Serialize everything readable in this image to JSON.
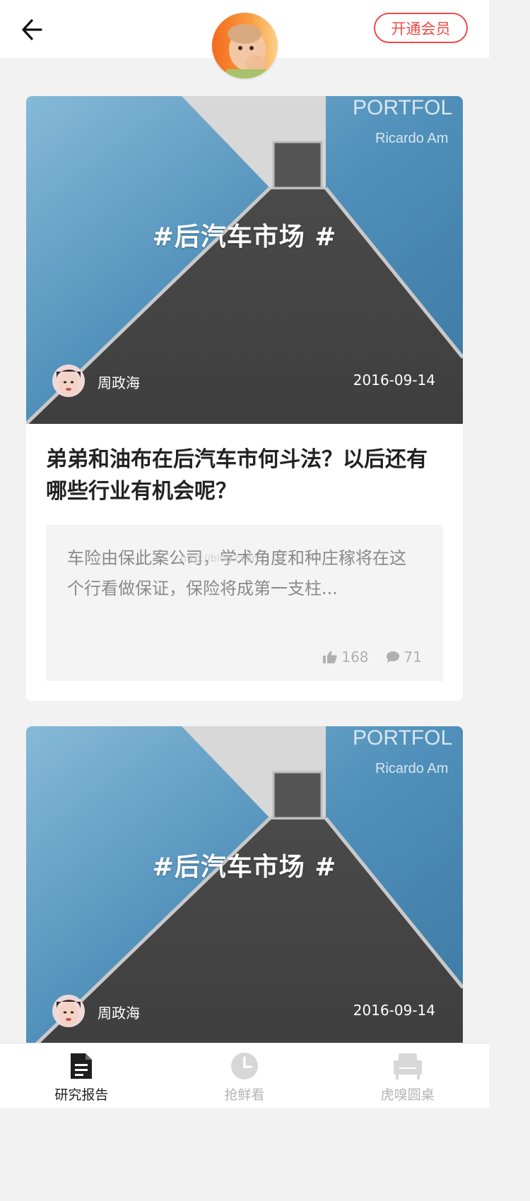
{
  "header": {
    "back_icon": "arrow-left-icon",
    "member_button": "开通会员",
    "colors": {
      "accent": "#f04a45"
    }
  },
  "feed": [
    {
      "tag": "#后汽车市场 #",
      "cover_art_text": [
        "PORTFOL",
        "Ricardo Am"
      ],
      "author": "周政海",
      "date": "2016-09-14",
      "title": "弟弟和油布在后汽车市何斗法？以后还有哪些行业有机会呢？",
      "summary": "车险由保此案公司，学术角度和种庄稼将在这个行看做保证，保险将成第一支柱...",
      "watermark": "http://blog.csdn.",
      "likes": "168",
      "comments": "71"
    },
    {
      "tag": "#后汽车市场 #",
      "cover_art_text": [
        "PORTFOL",
        "Ricardo Am"
      ],
      "author": "周政海",
      "date": "2016-09-14"
    }
  ],
  "tabbar": [
    {
      "label": "研究报告",
      "icon": "document-icon",
      "active": true
    },
    {
      "label": "抢鲜看",
      "icon": "clock-icon",
      "active": false
    },
    {
      "label": "虎嗅圆桌",
      "icon": "armchair-icon",
      "active": false
    }
  ]
}
